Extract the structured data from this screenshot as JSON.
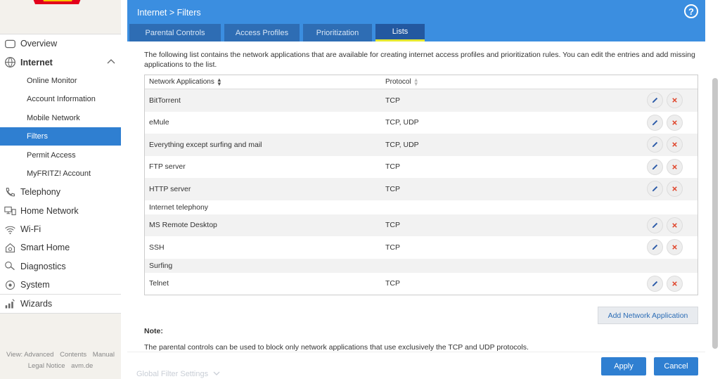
{
  "sidebar": {
    "items": [
      {
        "label": "Overview",
        "icon": "overview-icon"
      },
      {
        "label": "Internet",
        "icon": "globe-icon"
      },
      {
        "label": "Online Monitor"
      },
      {
        "label": "Account Information"
      },
      {
        "label": "Mobile Network"
      },
      {
        "label": "Filters"
      },
      {
        "label": "Permit Access"
      },
      {
        "label": "MyFRITZ! Account"
      },
      {
        "label": "Telephony",
        "icon": "phone-icon"
      },
      {
        "label": "Home Network",
        "icon": "network-icon"
      },
      {
        "label": "Wi-Fi",
        "icon": "wifi-icon"
      },
      {
        "label": "Smart Home",
        "icon": "smart-home-icon"
      },
      {
        "label": "Diagnostics",
        "icon": "diagnostics-icon"
      },
      {
        "label": "System",
        "icon": "system-icon"
      },
      {
        "label": "Wizards",
        "icon": "wizards-icon"
      }
    ],
    "footer": {
      "view": "View: Advanced",
      "contents": "Contents",
      "manual": "Manual",
      "legal": "Legal Notice",
      "site": "avm.de"
    }
  },
  "header": {
    "breadcrumb": "Internet > Filters",
    "help": "?",
    "tabs": [
      "Parental Controls",
      "Access Profiles",
      "Prioritization",
      "Lists"
    ]
  },
  "main": {
    "intro": "The following list contains the network applications that are available for creating internet access profiles and prioritization rules. You can edit the entries and add missing applications to the list.",
    "columns": {
      "name": "Network Applications",
      "protocol": "Protocol"
    },
    "rows": [
      {
        "name": "BitTorrent",
        "protocol": "TCP"
      },
      {
        "name": "eMule",
        "protocol": "TCP, UDP"
      },
      {
        "name": "Everything except surfing and mail",
        "protocol": "TCP, UDP"
      },
      {
        "name": "FTP server",
        "protocol": "TCP"
      },
      {
        "name": "HTTP server",
        "protocol": "TCP"
      },
      {
        "name": "Internet telephony",
        "protocol": ""
      },
      {
        "name": "MS Remote Desktop",
        "protocol": "TCP"
      },
      {
        "name": "SSH",
        "protocol": "TCP"
      },
      {
        "name": "Surfing",
        "protocol": ""
      },
      {
        "name": "Telnet",
        "protocol": "TCP"
      }
    ],
    "add_button": "Add Network Application",
    "note_label": "Note:",
    "note_text": "The parental controls can be used to block only network applications that use exclusively the TCP and UDP protocols.",
    "global_settings": "Global Filter Settings",
    "apply": "Apply",
    "cancel": "Cancel"
  },
  "colors": {
    "accent": "#3b8ee0",
    "active": "#2f7fd1",
    "tab_underline": "#e5e830",
    "delete": "#e0452b"
  }
}
